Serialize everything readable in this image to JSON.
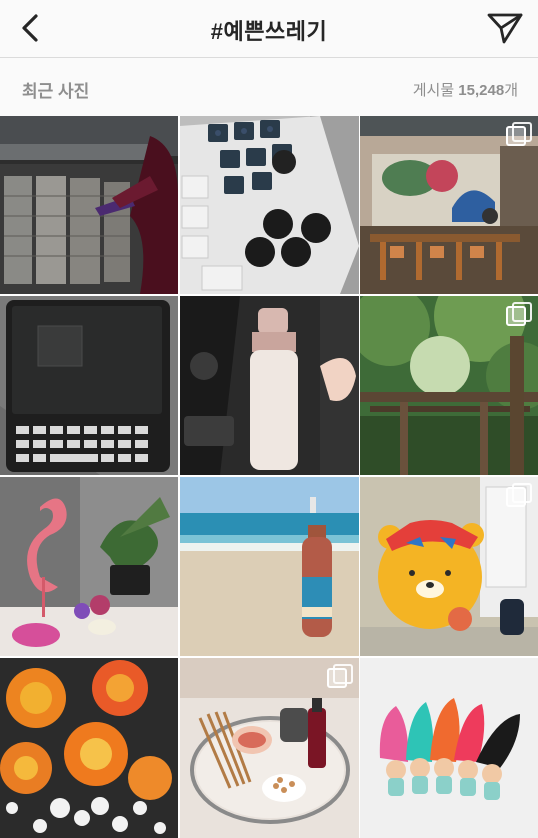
{
  "header": {
    "title": "#예쁜쓰레기",
    "back_icon": "chevron-left-icon",
    "send_icon": "paper-plane-icon"
  },
  "section": {
    "title": "최근 사진",
    "count_label": "게시물",
    "count_value": "15,248",
    "count_unit": "개"
  },
  "posts": [
    {
      "subject": "subway-turnstiles-heels",
      "multi": false
    },
    {
      "subject": "mechanical-keyboard-keycaps",
      "multi": false
    },
    {
      "subject": "cafe-interior-mural",
      "multi": true
    },
    {
      "subject": "blackberry-phone",
      "multi": false
    },
    {
      "subject": "starbucks-tumbler-in-car",
      "multi": false
    },
    {
      "subject": "forest-torii-gate",
      "multi": true
    },
    {
      "subject": "flamingo-lamp",
      "multi": false
    },
    {
      "subject": "beach-bottle",
      "multi": false
    },
    {
      "subject": "ryan-character-toy",
      "multi": true
    },
    {
      "subject": "orange-roses",
      "multi": false
    },
    {
      "subject": "tray-with-snacks",
      "multi": true
    },
    {
      "subject": "troll-dolls",
      "multi": false
    }
  ]
}
